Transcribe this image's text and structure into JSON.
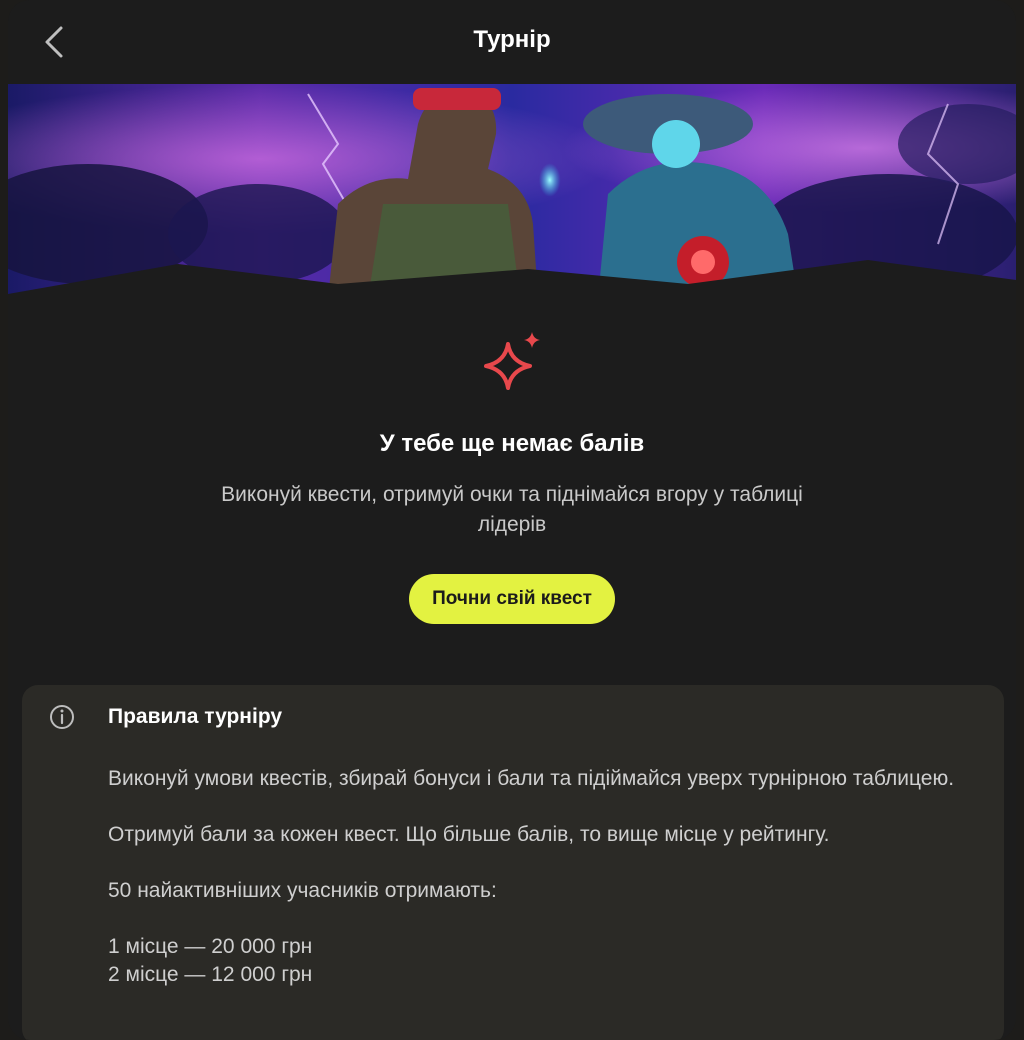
{
  "header": {
    "title": "Турнір",
    "back_icon": "chevron-left-icon"
  },
  "banner": {
    "description_icon": "tournament-banner-image"
  },
  "empty_state": {
    "icon": "sparkle-icon",
    "icon_color": "#e8484c",
    "title": "У тебе ще немає балів",
    "description": "Виконуй квести, отримуй очки та піднімайся вгору у таблиці лідерів",
    "cta_label": "Почни свій квест",
    "cta_color": "#e3f241"
  },
  "rules": {
    "icon": "info-icon",
    "title": "Правила турніру",
    "paragraph_1": "Виконуй умови квестів, збирай бонуси і бали та підіймайся уверх турнірною таблицею.",
    "paragraph_2": "Отримуй бали за кожен квест. Що більше балів, то вище місце у рейтингу.",
    "paragraph_3": "50 найактивніших учасників отримають:",
    "prizes": [
      "1 місце — 20 000 грн",
      "2 місце — 12 000 грн"
    ]
  }
}
